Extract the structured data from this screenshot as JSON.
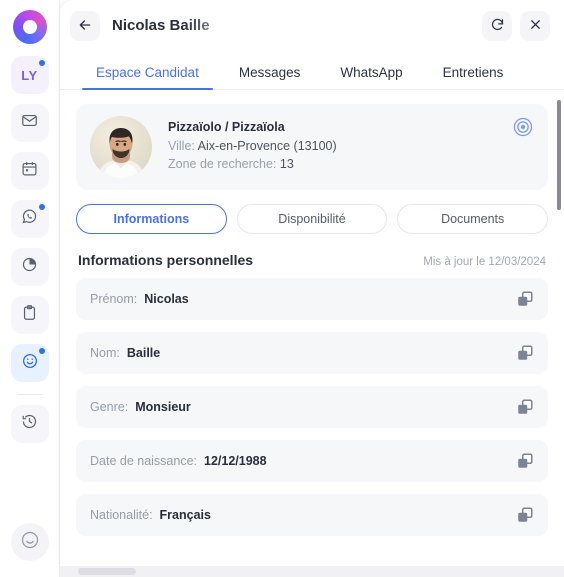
{
  "colors": {
    "accent": "#4a72e8",
    "panel_bg": "#ffffff",
    "field_bg": "#f6f7f9",
    "muted_text": "#969cab",
    "dark_text": "#2a2e3d",
    "badge_dot": "#2f6fe8"
  },
  "sidebar": {
    "logo_name": "app-logo",
    "items": [
      {
        "id": "ly",
        "label": "LY",
        "icon": "initials-avatar",
        "badge": true,
        "active": false
      },
      {
        "id": "mail",
        "label": "",
        "icon": "mail-icon",
        "badge": false,
        "active": false
      },
      {
        "id": "calendar",
        "label": "",
        "icon": "calendar-icon",
        "badge": false,
        "active": false
      },
      {
        "id": "whatsapp",
        "label": "",
        "icon": "whatsapp-icon",
        "badge": true,
        "active": false
      },
      {
        "id": "stats",
        "label": "",
        "icon": "pie-chart-icon",
        "badge": false,
        "active": false
      },
      {
        "id": "clipboard",
        "label": "",
        "icon": "clipboard-icon",
        "badge": false,
        "active": false
      },
      {
        "id": "candidates",
        "label": "",
        "icon": "smiley-icon",
        "badge": true,
        "active": true
      },
      {
        "id": "history",
        "label": "",
        "icon": "history-clock-icon",
        "badge": false,
        "active": false
      }
    ],
    "bottom_item": {
      "id": "profile",
      "icon": "smiley-icon"
    }
  },
  "header": {
    "back_icon": "arrow-left-icon",
    "title": "Nicolas Baille",
    "refresh_icon": "refresh-icon",
    "close_icon": "close-icon"
  },
  "tabs": [
    {
      "label": "Espace Candidat",
      "active": true
    },
    {
      "label": "Messages",
      "active": false
    },
    {
      "label": "WhatsApp",
      "active": false
    },
    {
      "label": "Entretiens",
      "active": false
    }
  ],
  "profile_card": {
    "avatar_alt": "candidate-photo",
    "job_title": "Pizzaïolo / Pizzaïola",
    "city_label": "Ville:",
    "city_value": "Aix-en-Provence (13100)",
    "zone_label": "Zone de recherche:",
    "zone_value": "13",
    "action_icon": "target-eye-icon"
  },
  "segments": [
    {
      "label": "Informations",
      "active": true
    },
    {
      "label": "Disponibilité",
      "active": false
    },
    {
      "label": "Documents",
      "active": false
    }
  ],
  "section": {
    "title": "Informations personnelles",
    "updated": "Mis à jour le 12/03/2024"
  },
  "fields": [
    {
      "label": "Prénom:",
      "value": "Nicolas",
      "copy_icon": "copy-icon"
    },
    {
      "label": "Nom:",
      "value": "Baille",
      "copy_icon": "copy-icon"
    },
    {
      "label": "Genre:",
      "value": "Monsieur",
      "copy_icon": "copy-icon"
    },
    {
      "label": "Date de naissance:",
      "value": "12/12/1988",
      "copy_icon": "copy-icon"
    },
    {
      "label": "Nationalité:",
      "value": "Français",
      "copy_icon": "copy-icon"
    }
  ]
}
